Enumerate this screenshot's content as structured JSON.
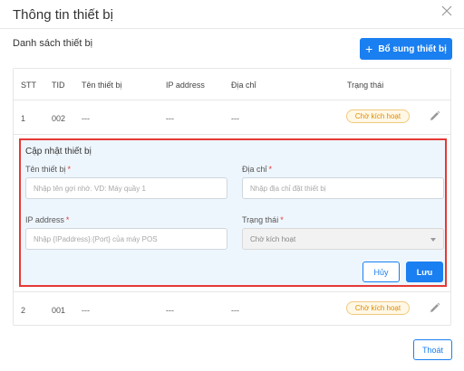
{
  "dialog": {
    "title": "Thông tin thiết bị",
    "close_icon": "close-icon"
  },
  "list": {
    "title": "Danh sách thiết bị",
    "add_button": "Bổ sung thiết bị"
  },
  "table": {
    "headers": [
      "STT",
      "TID",
      "Tên thiết bị",
      "IP address",
      "Địa chỉ",
      "Trạng thái"
    ],
    "rows": [
      {
        "stt": "1",
        "tid": "002",
        "name": "---",
        "ip": "---",
        "address": "---",
        "status": "Chờ kích hoạt"
      },
      {
        "stt": "2",
        "tid": "001",
        "name": "---",
        "ip": "---",
        "address": "---",
        "status": "Chờ kích hoạt"
      }
    ]
  },
  "edit_form": {
    "title": "Cập nhật thiết bị",
    "name_label": "Tên thiết bị",
    "name_placeholder": "Nhập tên gợi nhớ. VD: Máy quầy 1",
    "address_label": "Địa chỉ",
    "address_placeholder": "Nhập địa chỉ đặt thiết bị",
    "ip_label": "IP address",
    "ip_placeholder": "Nhập {IPaddress}:{Port} của máy POS",
    "status_label": "Trạng thái",
    "status_value": "Chờ kích hoạt",
    "required_mark": "*",
    "cancel_button": "Hủy",
    "save_button": "Lưu"
  },
  "footer": {
    "exit_button": "Thoát"
  },
  "colors": {
    "primary": "#1a7ff0",
    "highlight_border": "#e53935",
    "badge_text": "#e08a00"
  }
}
